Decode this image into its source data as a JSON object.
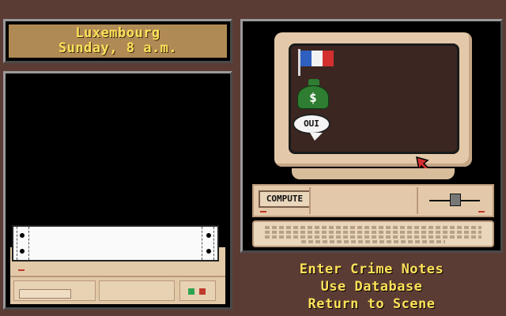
{
  "location": {
    "city": "Luxembourg",
    "time": "Sunday, 8 a.m."
  },
  "computer": {
    "compute_label": "COMPUTE",
    "icons": [
      {
        "name": "french-flag-icon"
      },
      {
        "name": "money-bag-icon",
        "symbol": "$"
      },
      {
        "name": "speech-bubble-icon",
        "text": "OUI"
      }
    ]
  },
  "menu": {
    "items": [
      {
        "label": "Enter Crime Notes"
      },
      {
        "label": "Use Database"
      },
      {
        "label": "Return to Scene"
      }
    ]
  },
  "colors": {
    "background": "#5b3c34",
    "text_yellow": "#ffe25a",
    "plaque": "#b08a55",
    "beige": "#e3c9a9"
  }
}
